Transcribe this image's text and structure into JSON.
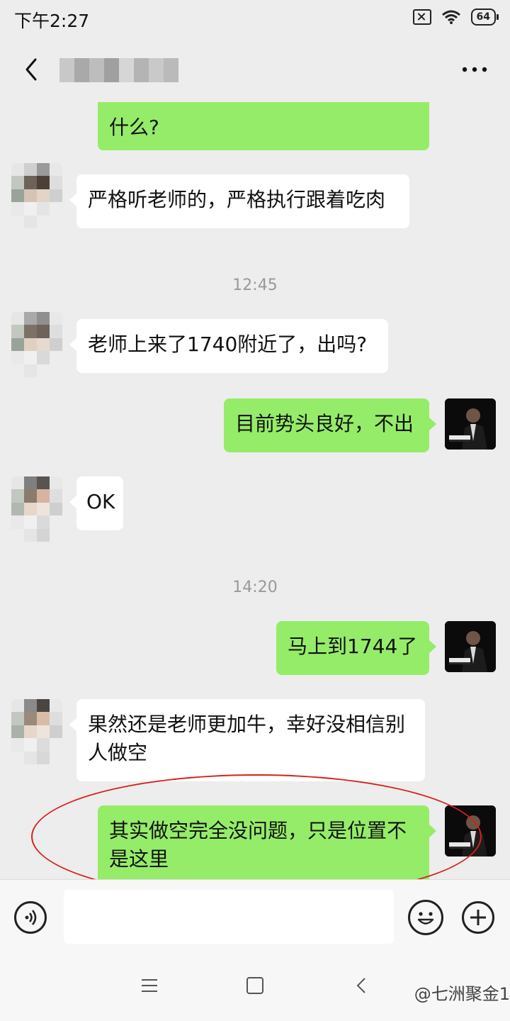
{
  "status_bar": {
    "time": "下午2:27",
    "battery": "64",
    "icons": [
      "sim-off-icon",
      "wifi-icon",
      "battery-icon"
    ]
  },
  "header": {
    "back_icon": "chevron-left-icon",
    "more_icon": "more-dots-icon"
  },
  "messages": [
    {
      "side": "out",
      "text": "什么?"
    },
    {
      "side": "in",
      "text": "严格听老师的，严格执行跟着吃肉"
    },
    {
      "side": "time",
      "text": "12:45"
    },
    {
      "side": "in",
      "text": "老师上来了1740附近了，出吗?"
    },
    {
      "side": "out",
      "text": "目前势头良好，不出"
    },
    {
      "side": "in",
      "text": "OK"
    },
    {
      "side": "time",
      "text": "14:20"
    },
    {
      "side": "out",
      "text": "马上到1744了"
    },
    {
      "side": "in",
      "text": "果然还是老师更加牛，幸好没相信别人做空"
    },
    {
      "side": "out",
      "text": "其实做空完全没问题，只是位置不是这里"
    }
  ],
  "input_bar": {
    "voice_icon": "voice-icon",
    "emoji_icon": "emoji-icon",
    "plus_icon": "plus-icon"
  },
  "nav_bar": {
    "icons": [
      "menu-icon",
      "home-icon",
      "back-icon"
    ],
    "watermark": "@七洲聚金1"
  },
  "colors": {
    "outgoing_bubble": "#95ec69",
    "incoming_bubble": "#ffffff",
    "background": "#ededed",
    "annotation": "#d8201e"
  }
}
